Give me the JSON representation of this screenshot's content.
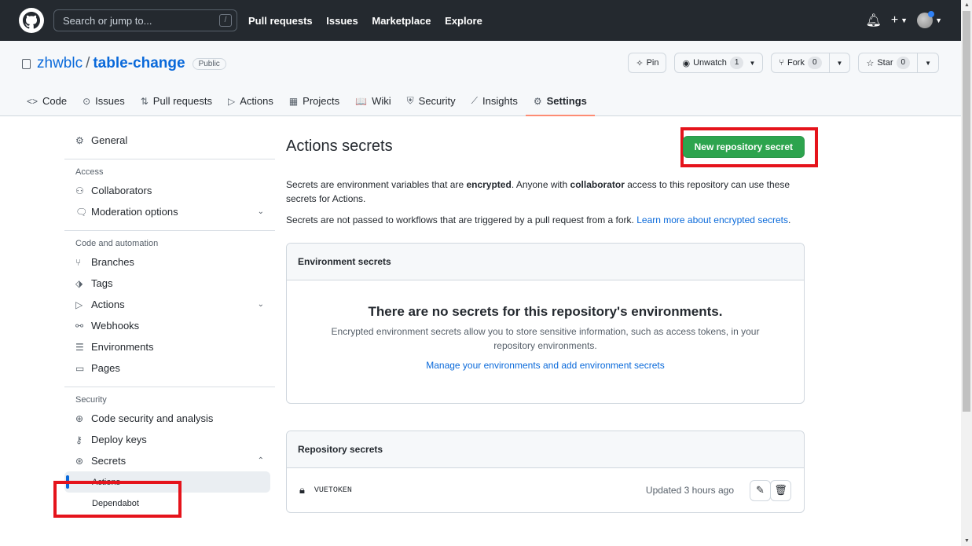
{
  "header": {
    "search_placeholder": "Search or jump to...",
    "slash_key": "/",
    "nav": [
      "Pull requests",
      "Issues",
      "Marketplace",
      "Explore"
    ],
    "icons": [
      "bell-icon",
      "plus-icon"
    ]
  },
  "repo": {
    "owner": "zhwblc",
    "separator": "/",
    "name": "table-change",
    "visibility": "Public",
    "pin_label": "Pin",
    "unwatch_label": "Unwatch",
    "unwatch_count": "1",
    "fork_label": "Fork",
    "fork_count": "0",
    "star_label": "Star",
    "star_count": "0"
  },
  "tabs": [
    {
      "label": "Code",
      "icon": "<>"
    },
    {
      "label": "Issues",
      "icon": "⊙"
    },
    {
      "label": "Pull requests",
      "icon": "⇅"
    },
    {
      "label": "Actions",
      "icon": "▷"
    },
    {
      "label": "Projects",
      "icon": "▦"
    },
    {
      "label": "Wiki",
      "icon": "📖"
    },
    {
      "label": "Security",
      "icon": "⛨"
    },
    {
      "label": "Insights",
      "icon": "⟋"
    },
    {
      "label": "Settings",
      "icon": "⚙"
    }
  ],
  "sidebar": {
    "general": "General",
    "access_heading": "Access",
    "collaborators": "Collaborators",
    "moderation": "Moderation options",
    "code_heading": "Code and automation",
    "branches": "Branches",
    "tags": "Tags",
    "actions": "Actions",
    "webhooks": "Webhooks",
    "environments": "Environments",
    "pages": "Pages",
    "security_heading": "Security",
    "code_security": "Code security and analysis",
    "deploy_keys": "Deploy keys",
    "secrets": "Secrets",
    "secrets_actions": "Actions",
    "secrets_dependabot": "Dependabot"
  },
  "main": {
    "title": "Actions secrets",
    "new_button": "New repository secret",
    "desc1_a": "Secrets are environment variables that are ",
    "desc1_b": "encrypted",
    "desc1_c": ". Anyone with ",
    "desc1_d": "collaborator",
    "desc1_e": " access to this repository can use these secrets for Actions.",
    "desc2": "Secrets are not passed to workflows that are triggered by a pull request from a fork. ",
    "desc2_link": "Learn more about encrypted secrets",
    "desc2_end": ".",
    "env_heading": "Environment secrets",
    "env_empty_title": "There are no secrets for this repository's environments.",
    "env_empty_desc": "Encrypted environment secrets allow you to store sensitive information, such as access tokens, in your repository environments.",
    "env_link": "Manage your environments and add environment secrets",
    "repo_heading": "Repository secrets",
    "secret_name": "VUETOKEN",
    "secret_updated": "Updated 3 hours ago"
  },
  "colors": {
    "highlight": "#e5131b",
    "primary_button": "#2da44e",
    "accent": "#0969da"
  }
}
